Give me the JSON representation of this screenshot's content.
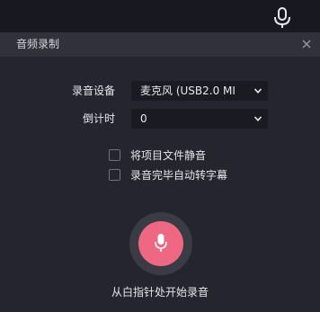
{
  "window": {
    "title": "音频录制"
  },
  "settings": {
    "device_label": "录音设备",
    "device_value": "麦克风 (USB2.0 MI",
    "countdown_label": "倒计时",
    "countdown_value": "0"
  },
  "options": [
    {
      "label": "将项目文件静音",
      "checked": false
    },
    {
      "label": "录音完毕自动转字幕",
      "checked": false
    }
  ],
  "record": {
    "hint": "从白指针处开始录音"
  },
  "icons": {
    "top": "microphone-icon",
    "close": "close-icon",
    "chevron": "chevron-down-icon",
    "record": "microphone-icon"
  },
  "colors": {
    "accent": "#ef6883",
    "panel": "#24252e",
    "header": "#30313b"
  }
}
